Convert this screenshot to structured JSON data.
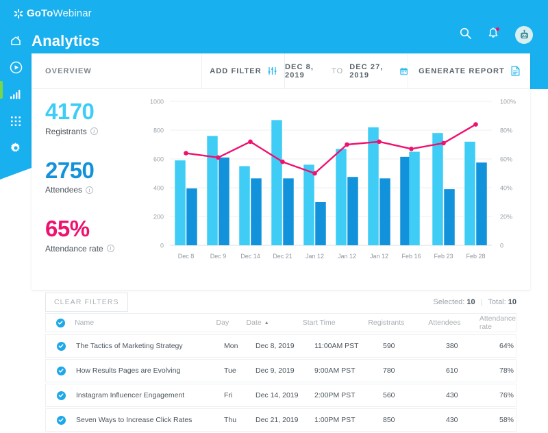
{
  "brand": {
    "logo_bold": "GoTo",
    "logo_light": "Webinar",
    "colors": {
      "blue": "#18B0EF",
      "registrants": "#3FCDF6",
      "attendees": "#1192DB",
      "rate": "#F0116F",
      "active_indicator": "#76D74C"
    }
  },
  "header": {
    "title": "Analytics",
    "icons": [
      "search-icon",
      "bell-icon",
      "avatar"
    ]
  },
  "sidebar": {
    "items": [
      {
        "icon": "home-icon",
        "active": false
      },
      {
        "icon": "play-circle-icon",
        "active": false
      },
      {
        "icon": "bar-chart-icon",
        "active": true
      },
      {
        "icon": "grid-apps-icon",
        "active": false
      },
      {
        "icon": "gear-icon",
        "active": false
      }
    ]
  },
  "toolbar": {
    "overview_label": "OVERVIEW",
    "add_filter_label": "ADD FILTER",
    "date_from": "DEC 8, 2019",
    "date_to_label": "TO",
    "date_to": "DEC 27, 2019",
    "generate_report_label": "GENERATE REPORT"
  },
  "kpis": [
    {
      "value": "4170",
      "label": "Registrants",
      "color": "#3FCDF6"
    },
    {
      "value": "2750",
      "label": "Attendees",
      "color": "#1192DB"
    },
    {
      "value": "65%",
      "label": "Attendance rate",
      "color": "#F0116F"
    }
  ],
  "filters": {
    "clear_label": "CLEAR FILTERS",
    "selected_label": "Selected:",
    "selected_value": "10",
    "total_label": "Total:",
    "total_value": "10"
  },
  "table": {
    "columns": [
      "Name",
      "Day",
      "Date",
      "Start Time",
      "Registrants",
      "Attendees",
      "Attendance rate"
    ],
    "sorted_column": "Date",
    "sort_direction": "asc",
    "rows": [
      {
        "checked": true,
        "name": "The Tactics of Marketing Strategy",
        "day": "Mon",
        "date": "Dec 8, 2019",
        "time": "11:00AM PST",
        "registrants": "590",
        "attendees": "380",
        "rate": "64%"
      },
      {
        "checked": true,
        "name": "How Results Pages are Evolving",
        "day": "Tue",
        "date": "Dec 9, 2019",
        "time": "9:00AM PST",
        "registrants": "780",
        "attendees": "610",
        "rate": "78%"
      },
      {
        "checked": true,
        "name": "Instagram Influencer Engagement",
        "day": "Fri",
        "date": "Dec 14, 2019",
        "time": "2:00PM PST",
        "registrants": "560",
        "attendees": "430",
        "rate": "76%"
      },
      {
        "checked": true,
        "name": "Seven Ways to Increase Click Rates",
        "day": "Thu",
        "date": "Dec 21, 2019",
        "time": "1:00PM PST",
        "registrants": "850",
        "attendees": "430",
        "rate": "58%"
      }
    ]
  },
  "chart_data": {
    "type": "bar",
    "title": "",
    "xlabel": "",
    "ylabel": "",
    "categories": [
      "Dec 8",
      "Dec 9",
      "Dec 14",
      "Dec 21",
      "Jan 12",
      "Jan 12",
      "Jan 12",
      "Feb 16",
      "Feb 23",
      "Feb 28"
    ],
    "series": [
      {
        "name": "Registrants",
        "color": "#3FCDF6",
        "values": [
          590,
          760,
          550,
          870,
          560,
          670,
          820,
          650,
          780,
          720
        ]
      },
      {
        "name": "Attendees",
        "color": "#1192DB",
        "values": [
          395,
          610,
          465,
          465,
          300,
          475,
          465,
          615,
          390,
          575
        ]
      },
      {
        "name": "Attendance rate",
        "color": "#F0116F",
        "type": "line",
        "axis": "right",
        "values": [
          64,
          61,
          72,
          58,
          50,
          70,
          72,
          67,
          71,
          84
        ]
      }
    ],
    "y_left_ticks": [
      0,
      200,
      400,
      600,
      800,
      1000
    ],
    "y_right_ticks": [
      "0",
      "20%",
      "40%",
      "60%",
      "80%",
      "100%"
    ],
    "ylim": [
      0,
      1000
    ],
    "y2lim": [
      0,
      100
    ],
    "grid": true,
    "legend": "none"
  }
}
